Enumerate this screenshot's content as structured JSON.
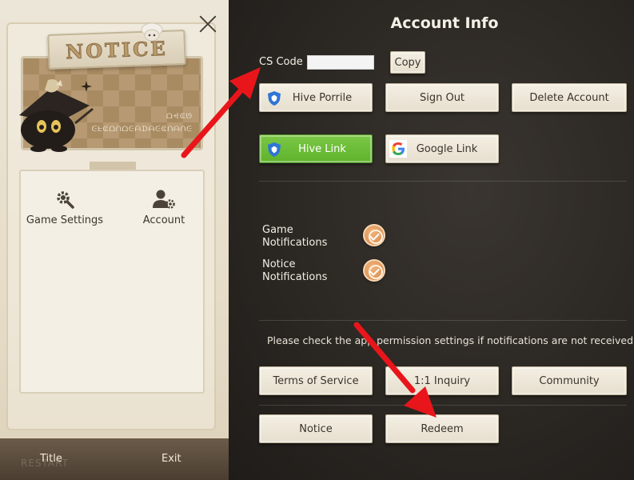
{
  "left_panel": {
    "banner_title": "NOTICE",
    "banner_glyph_line1": "ᗝ⩤ᕳᘎ",
    "banner_glyph_line2": "ᕮᖶᕳᗝᑎᗝᕮᗩᗪᗩᕮᕳᑎᗩᑎᕮ",
    "menu": {
      "game_settings": "Game Settings",
      "account": "Account"
    },
    "footer": {
      "title": "Title",
      "exit": "Exit",
      "ghost": "RESTART"
    }
  },
  "account_info": {
    "title": "Account Info",
    "cs_code_label": "CS Code :",
    "cs_code_value": "",
    "copy": "Copy",
    "hive_porrile": "Hive Porrile",
    "sign_out": "Sign Out",
    "delete_account": "Delete Account",
    "hive_link": "Hive Link",
    "google_link": "Google Link",
    "game_notifications_l1": "Game",
    "game_notifications_l2": "Notifications",
    "notice_notifications_l1": "Notice",
    "notice_notifications_l2": "Notifications",
    "permission_note": "Please check the app permission settings if notifications are not received",
    "terms_of_service": "Terms of Service",
    "inquiry": "1:1 Inquiry",
    "community": "Community",
    "notice": "Notice",
    "redeem": "Redeem"
  },
  "colors": {
    "hive_green": "#6bbd38",
    "arrow_red": "#e8161b",
    "check_orange": "#de8c4c"
  }
}
